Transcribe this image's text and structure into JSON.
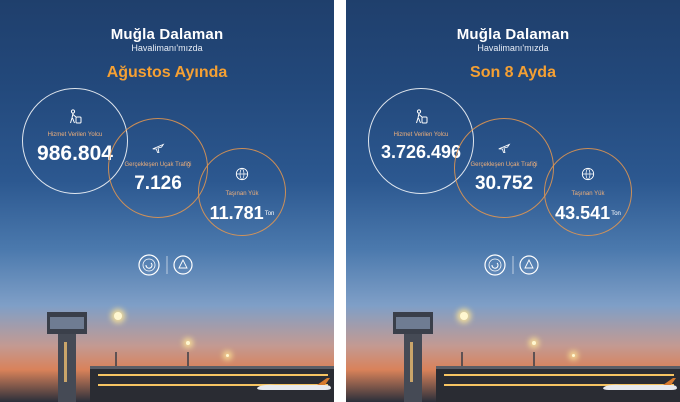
{
  "panels": [
    {
      "title": "Muğla Dalaman",
      "subtitle": "Havalimanı'mızda",
      "heading": "Ağustos Ayında",
      "stats": {
        "passengers": {
          "label": "Hizmet Verilen Yolcu",
          "value": "986.804",
          "icon": "passenger-luggage-icon"
        },
        "flights": {
          "label": "Gerçekleşen Uçak Trafiği",
          "value": "7.126",
          "icon": "airplane-icon"
        },
        "cargo": {
          "label": "Taşınan Yük",
          "value": "11.781",
          "unit": "Ton",
          "icon": "cargo-globe-icon"
        }
      }
    },
    {
      "title": "Muğla Dalaman",
      "subtitle": "Havalimanı'mızda",
      "heading": "Son 8 Ayda",
      "stats": {
        "passengers": {
          "label": "Hizmet Verilen Yolcu",
          "value": "3.726.496",
          "icon": "passenger-luggage-icon"
        },
        "flights": {
          "label": "Gerçekleşen Uçak Trafiği",
          "value": "30.752",
          "icon": "airplane-icon"
        },
        "cargo": {
          "label": "Taşınan Yük",
          "value": "43.541",
          "unit": "Ton",
          "icon": "cargo-globe-icon"
        }
      }
    }
  ],
  "colors": {
    "accent": "#f5a033",
    "circle_orange": "#e8984e",
    "sky_top": "#1f3f6c",
    "sunset": "#d9825a"
  }
}
